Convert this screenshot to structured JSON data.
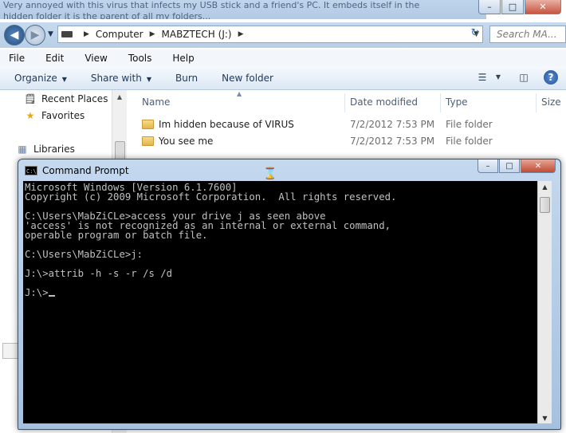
{
  "background_text": {
    "line1": "Very annoyed with this virus that infects my USB stick and a friend's PC. It embeds itself in the",
    "line2": "hidden folder it is the parent of all my folders..."
  },
  "explorer": {
    "window_controls": {
      "minimize": "–",
      "maximize": "□",
      "close": "✕"
    },
    "address": {
      "segments": [
        "Computer",
        "MABZTECH (J:)"
      ]
    },
    "search_placeholder": "Search MA...",
    "menu": [
      "File",
      "Edit",
      "View",
      "Tools",
      "Help"
    ],
    "toolbar": {
      "organize": "Organize",
      "share_with": "Share with",
      "burn": "Burn",
      "new_folder": "New folder"
    },
    "nav_pane": {
      "recent_places": "Recent Places",
      "favorites": "Favorites",
      "libraries": "Libraries"
    },
    "columns": {
      "name": "Name",
      "date_modified": "Date modified",
      "type": "Type",
      "size": "Size"
    },
    "files": [
      {
        "name": "Im hidden because of VIRUS",
        "date": "7/2/2012 7:53 PM",
        "type": "File folder"
      },
      {
        "name": "You see me",
        "date": "7/2/2012 7:53 PM",
        "type": "File folder"
      }
    ]
  },
  "cmd": {
    "title": "Command Prompt",
    "controls": {
      "minimize": "–",
      "maximize": "□",
      "close": "✕"
    },
    "lines": {
      "l1": "Microsoft Windows [Version 6.1.7600]",
      "l2": "Copyright (c) 2009 Microsoft Corporation.  All rights reserved.",
      "l3": "",
      "l4": "C:\\Users\\MabZiCLe>access your drive j as seen above",
      "l5": "'access' is not recognized as an internal or external command,",
      "l6": "operable program or batch file.",
      "l7": "",
      "l8": "C:\\Users\\MabZiCLe>j:",
      "l9": "",
      "l10": "J:\\>attrib -h -s -r /s /d",
      "l11": "",
      "l12": "J:\\>"
    }
  },
  "icons": {
    "back": "back-arrow-icon",
    "forward": "forward-arrow-icon",
    "refresh": "refresh-icon",
    "recent": "recent-places-icon",
    "favorites": "star-icon",
    "libraries": "libraries-icon",
    "folder": "folder-icon",
    "help": "help-icon",
    "views": "view-options-icon",
    "preview": "preview-pane-icon",
    "hourglass": "hourglass-cursor-icon"
  }
}
